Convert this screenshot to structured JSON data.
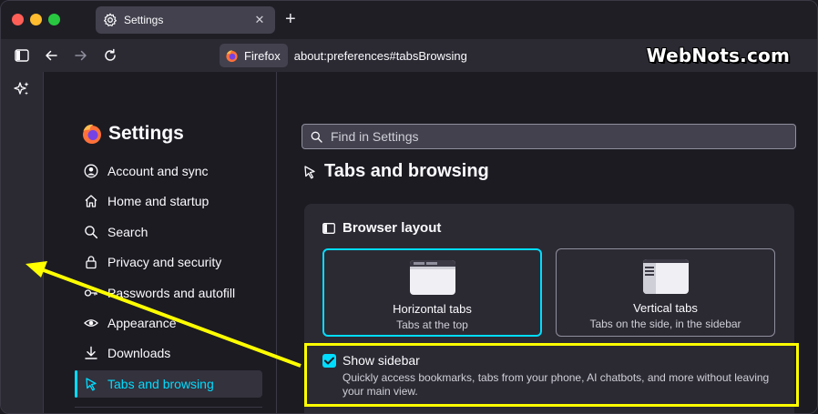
{
  "window": {
    "tab": {
      "title": "Settings",
      "icon": "gear-icon"
    },
    "new_tab_label": "+"
  },
  "toolbar": {
    "identity_label": "Firefox",
    "url": "about:preferences#tabsBrowsing",
    "watermark": "WebNots.com"
  },
  "sidebar_nav": {
    "title": "Settings",
    "items": [
      {
        "label": "Account and sync",
        "icon": "account-icon"
      },
      {
        "label": "Home and startup",
        "icon": "home-icon"
      },
      {
        "label": "Search",
        "icon": "search-icon"
      },
      {
        "label": "Privacy and security",
        "icon": "lock-icon"
      },
      {
        "label": "Passwords and autofill",
        "icon": "key-icon"
      },
      {
        "label": "Appearance",
        "icon": "eye-icon"
      },
      {
        "label": "Downloads",
        "icon": "download-icon"
      },
      {
        "label": "Tabs and browsing",
        "icon": "pointer-icon",
        "selected": true
      }
    ]
  },
  "main": {
    "search_placeholder": "Find in Settings",
    "section_title": "Tabs and browsing",
    "card": {
      "title": "Browser layout",
      "options": [
        {
          "title": "Horizontal tabs",
          "subtitle": "Tabs at the top",
          "selected": true
        },
        {
          "title": "Vertical tabs",
          "subtitle": "Tabs on the side, in the sidebar",
          "selected": false
        }
      ],
      "checkbox": {
        "label": "Show sidebar",
        "checked": true,
        "description": "Quickly access bookmarks, tabs from your phone, AI chatbots, and more without leaving your main view."
      }
    }
  },
  "colors": {
    "accent": "#00ddff",
    "annotation": "#ffff00",
    "background": "#1c1b22",
    "panel": "#2b2a33"
  }
}
